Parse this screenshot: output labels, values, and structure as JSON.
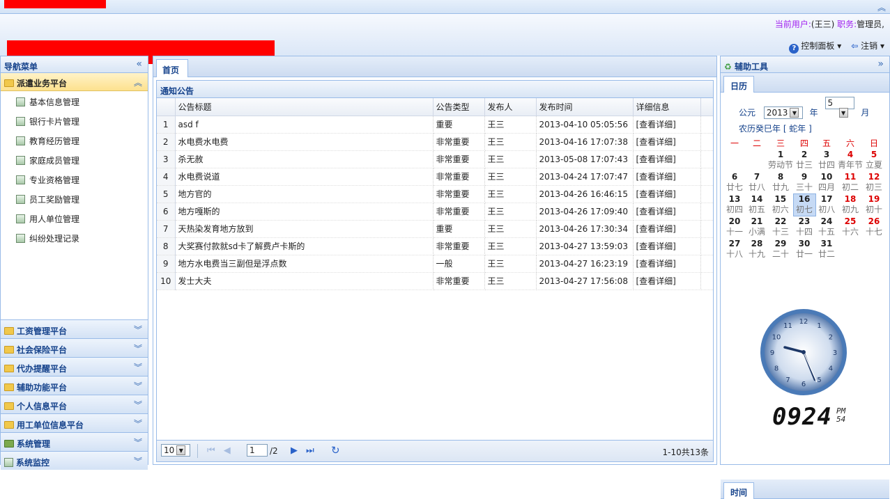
{
  "user": {
    "label": "当前用户:",
    "name": "(王三)",
    "role_label": "职务:",
    "role": "管理员,"
  },
  "controls": {
    "panel": "控制面板",
    "logout": "注销"
  },
  "nav": {
    "title": "导航菜单",
    "open_group": "派遣业务平台",
    "items": [
      "基本信息管理",
      "银行卡片管理",
      "教育经历管理",
      "家庭成员管理",
      "专业资格管理",
      "员工奖励管理",
      "用人单位管理",
      "纠纷处理记录"
    ],
    "groups": [
      "工资管理平台",
      "社会保险平台",
      "代办提醒平台",
      "辅助功能平台",
      "个人信息平台",
      "用工单位信息平台",
      "系统管理",
      "系统监控"
    ]
  },
  "center": {
    "tab": "首页",
    "grid_title": "通知公告",
    "columns": [
      "公告标题",
      "公告类型",
      "发布人",
      "发布时间",
      "详细信息"
    ],
    "rows": [
      [
        "1",
        "asd f",
        "重要",
        "王三",
        "2013-04-10 05:05:56",
        "[查看详细]"
      ],
      [
        "2",
        "水电费水电费",
        "非常重要",
        "王三",
        "2013-04-16 17:07:38",
        "[查看详细]"
      ],
      [
        "3",
        "杀无赦",
        "非常重要",
        "王三",
        "2013-05-08 17:07:43",
        "[查看详细]"
      ],
      [
        "4",
        "水电费说道",
        "非常重要",
        "王三",
        "2013-04-24 17:07:47",
        "[查看详细]"
      ],
      [
        "5",
        "地方官的",
        "非常重要",
        "王三",
        "2013-04-26 16:46:15",
        "[查看详细]"
      ],
      [
        "6",
        "地方嘎斯的",
        "非常重要",
        "王三",
        "2013-04-26 17:09:40",
        "[查看详细]"
      ],
      [
        "7",
        "天热染发育地方放到",
        "重要",
        "王三",
        "2013-04-26 17:30:34",
        "[查看详细]"
      ],
      [
        "8",
        "大奖赛付款就sd卡了解费卢卡斯的",
        "非常重要",
        "王三",
        "2013-04-27 13:59:03",
        "[查看详细]"
      ],
      [
        "9",
        "地方水电费当三副但是浮点数",
        "一般",
        "王三",
        "2013-04-27 16:23:19",
        "[查看详细]"
      ],
      [
        "10",
        "发士大夫",
        "非常重要",
        "王三",
        "2013-04-27 17:56:08",
        "[查看详细]"
      ]
    ],
    "pager": {
      "page_size": "10",
      "page": "1",
      "total_pages": "/2",
      "summary": "1-10共13条"
    }
  },
  "tools": {
    "title": "辅助工具",
    "cal_tab": "日历",
    "era": "公元",
    "year": "2013",
    "year_unit": "年",
    "month": "5",
    "month_unit": "月",
    "lunar": "农历癸巳年 [ 蛇年 ]",
    "weekdays": [
      "一",
      "二",
      "三",
      "四",
      "五",
      "六",
      "日"
    ],
    "weeks": [
      [
        [
          "",
          ""
        ],
        [
          "",
          ""
        ],
        [
          "1",
          "劳动节"
        ],
        [
          "2",
          "廿三"
        ],
        [
          "3",
          "廿四"
        ],
        [
          "4",
          "青年节"
        ],
        [
          "5",
          "立夏"
        ]
      ],
      [
        [
          "6",
          "廿七"
        ],
        [
          "7",
          "廿八"
        ],
        [
          "8",
          "廿九"
        ],
        [
          "9",
          "三十"
        ],
        [
          "10",
          "四月"
        ],
        [
          "11",
          "初二"
        ],
        [
          "12",
          "初三"
        ]
      ],
      [
        [
          "13",
          "初四"
        ],
        [
          "14",
          "初五"
        ],
        [
          "15",
          "初六"
        ],
        [
          "16",
          "初七"
        ],
        [
          "17",
          "初八"
        ],
        [
          "18",
          "初九"
        ],
        [
          "19",
          "初十"
        ]
      ],
      [
        [
          "20",
          "十一"
        ],
        [
          "21",
          "小满"
        ],
        [
          "22",
          "十三"
        ],
        [
          "23",
          "十四"
        ],
        [
          "24",
          "十五"
        ],
        [
          "25",
          "十六"
        ],
        [
          "26",
          "十七"
        ]
      ],
      [
        [
          "27",
          "十八"
        ],
        [
          "28",
          "十九"
        ],
        [
          "29",
          "二十"
        ],
        [
          "30",
          "廿一"
        ],
        [
          "31",
          "廿二"
        ],
        [
          "",
          ""
        ],
        [
          "",
          ""
        ]
      ]
    ],
    "today": "16",
    "time_tab": "时间",
    "clock_nums": [
      "12",
      "1",
      "2",
      "3",
      "4",
      "5",
      "6",
      "7",
      "8",
      "9",
      "10",
      "11"
    ],
    "digital": "0924",
    "ampm": "PM",
    "seconds": "54"
  }
}
